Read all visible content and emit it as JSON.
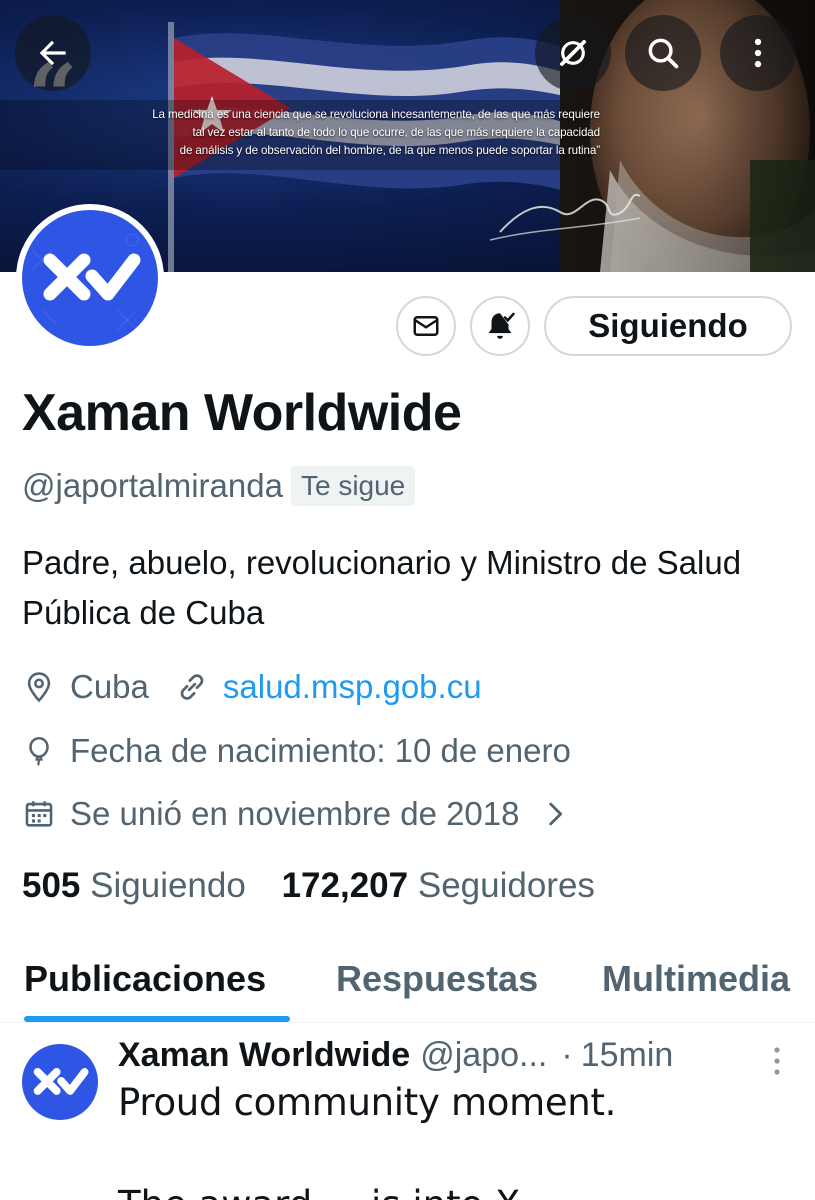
{
  "banner": {
    "quote": "La medicina es una ciencia que se revoluciona incesantemente, de las que más requiere tal vez estar al tanto de todo lo que ocurre, de las que más requiere la capacidad de análisis y de observación del hombre, de la que menos puede soportar la rutina”",
    "quote_line1": "La medicina es una ciencia que se revoluciona incesantemente, de las que más requiere",
    "quote_line2": "tal vez estar al tanto de todo lo que ocurre, de las que más requiere la capacidad",
    "quote_line3": "de análisis y de observación del hombre, de la que menos puede soportar la rutina”",
    "quote_mark": "“",
    "icons": [
      "back-arrow-icon",
      "grok-icon",
      "search-icon",
      "more-vertical-icon"
    ]
  },
  "profile": {
    "display_name": "Xaman Worldwide",
    "handle": "@japortalmiranda",
    "follows_you": "Te sigue",
    "bio": "Padre, abuelo, revolucionario y Ministro de Salud Pública de Cuba",
    "location": "Cuba",
    "website": "salud.msp.gob.cu",
    "birthday": "Fecha de nacimiento: 10 de enero",
    "joined": "Se unió en noviembre de 2018",
    "following_count": "505",
    "following_label": "Siguiendo",
    "followers_count": "172,207",
    "followers_label": "Seguidores"
  },
  "actions": {
    "follow_state_label": "Siguiendo",
    "message_icon": "mail-icon",
    "notify_icon": "bell-check-icon"
  },
  "tabs": [
    {
      "label": "Publicaciones",
      "active": true
    },
    {
      "label": "Respuestas",
      "active": false
    },
    {
      "label": "Multimedia",
      "active": false
    }
  ],
  "post": {
    "author_name": "Xaman Worldwide",
    "author_handle": "@japo...",
    "separator": "·",
    "time": "15min",
    "text": "Proud community moment.",
    "text_partial": "The award ... is into X..."
  },
  "colors": {
    "accent": "#1d9bf0",
    "avatar_blue": "#2f55e4",
    "secondary_text": "#536471",
    "primary_text": "#0f1419"
  }
}
